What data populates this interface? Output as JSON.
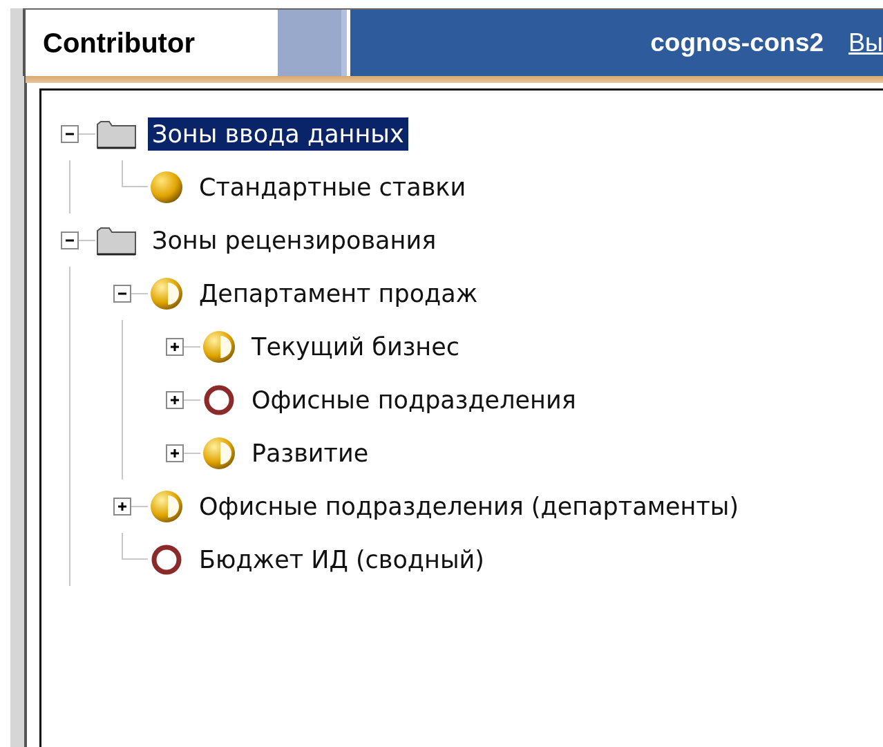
{
  "header": {
    "title": "Contributor",
    "server": "cognos-cons2",
    "logout_link": "Вы"
  },
  "tree": [
    {
      "label": "Зоны ввода данных",
      "kind": "folder",
      "expanded": true,
      "selected": true,
      "children": [
        {
          "label": "Стандартные ставки",
          "kind": "full",
          "selected": false
        }
      ]
    },
    {
      "label": "Зоны рецензирования",
      "kind": "folder",
      "expanded": true,
      "selected": false,
      "children": [
        {
          "label": "Департамент продаж",
          "kind": "half",
          "expanded": true,
          "selected": false,
          "children": [
            {
              "label": "Текущий бизнес",
              "kind": "half",
              "expanded": false,
              "selected": false
            },
            {
              "label": "Офисные подразделения",
              "kind": "empty",
              "expanded": false,
              "selected": false
            },
            {
              "label": "Развитие",
              "kind": "half",
              "expanded": false,
              "selected": false
            }
          ]
        },
        {
          "label": "Офисные подразделения (департаменты)",
          "kind": "half",
          "expanded": false,
          "selected": false
        },
        {
          "label": "Бюджет ИД (сводный)",
          "kind": "empty",
          "selected": false
        }
      ]
    }
  ]
}
